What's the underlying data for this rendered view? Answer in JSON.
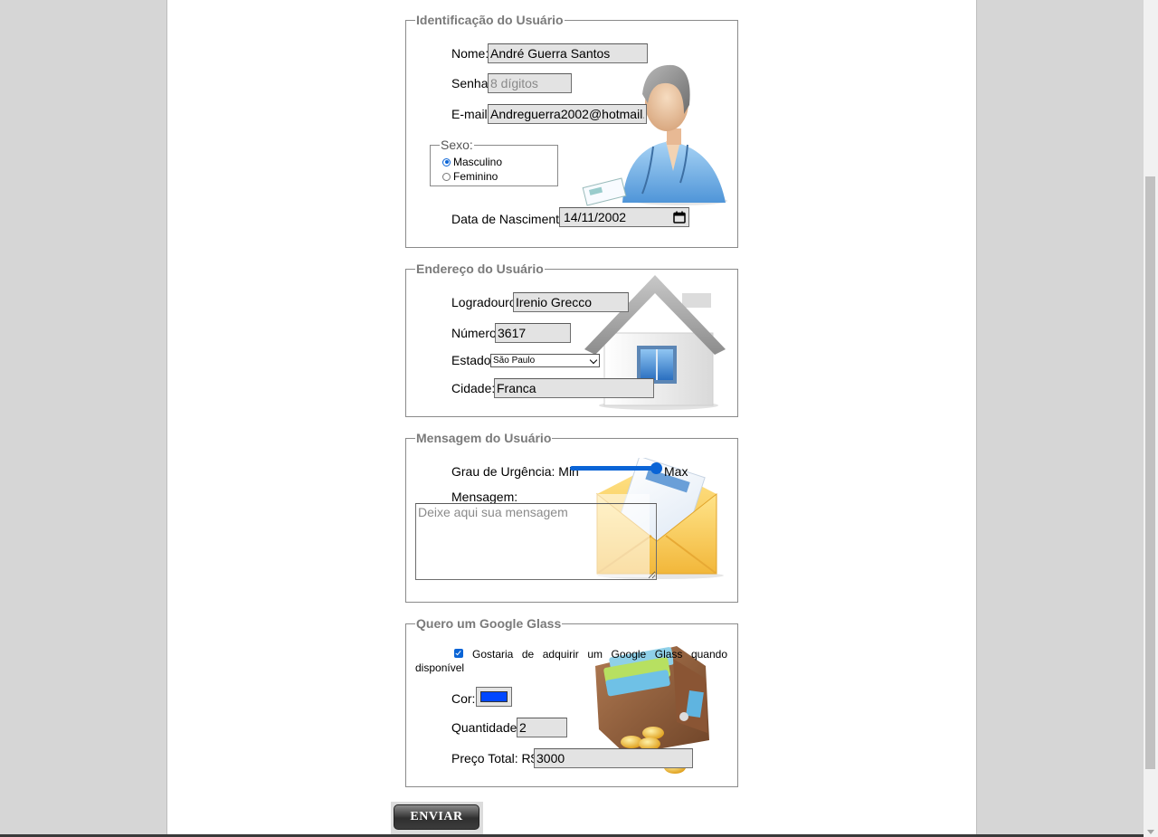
{
  "identification": {
    "legend": "Identificação do Usuário",
    "name_label": "Nome:",
    "name_value": "André Guerra Santos",
    "password_label": "Senha:",
    "password_placeholder": "8 dígitos",
    "email_label": "E-mail:",
    "email_value": "Andreguerra2002@hotmail.",
    "sex": {
      "legend": "Sexo:",
      "options": [
        {
          "label": "Masculino",
          "selected": true
        },
        {
          "label": "Feminino",
          "selected": false
        }
      ]
    },
    "birthdate_label": "Data de Nascimento:",
    "birthdate_value": "14/11/2002",
    "illustration_icon": "user-avatar-icon",
    "date_picker_icon": "calendar-icon"
  },
  "address": {
    "legend": "Endereço do Usuário",
    "street_label": "Logradouro:",
    "street_value": "Irenio Grecco",
    "number_label": "Número:",
    "number_value": "3617",
    "state_label": "Estado:",
    "state_value": "São Paulo",
    "city_label": "Cidade:",
    "city_value": "Franca",
    "illustration_icon": "house-icon"
  },
  "message": {
    "legend": "Mensagem do Usuário",
    "urgency_label": "Grau de Urgência: Min",
    "urgency_max": "Max",
    "urgency_level": 1.0,
    "message_label": "Mensagem:",
    "message_placeholder": "Deixe aqui sua mensagem",
    "illustration_icon": "envelope-icon"
  },
  "glass": {
    "legend": "Quero um Google Glass",
    "want_label": "Gostaria de adquirir um Google Glass quando disponível",
    "want_checked": true,
    "color_label": "Cor:",
    "color_value": "#0047ff",
    "quantity_label": "Quantidade:",
    "quantity_value": "2",
    "price_label": "Preço Total: R$",
    "price_value": "3000",
    "illustration_icon": "wallet-icon"
  },
  "submit": {
    "label": "ENVIAR"
  },
  "colors": {
    "accent": "#0a64d6",
    "legend_text": "#7a7a7a",
    "field_bg": "#e3e3e3"
  }
}
